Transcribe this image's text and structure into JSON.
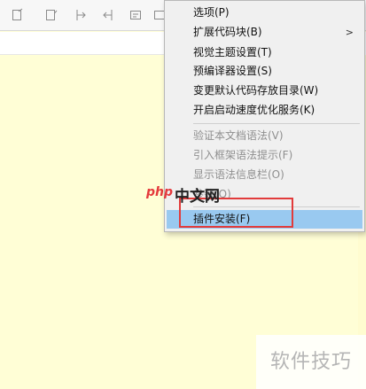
{
  "menu": {
    "items": [
      {
        "label": "选项(P)",
        "disabled": false
      },
      {
        "label": "扩展代码块(B)",
        "disabled": false,
        "submenu": true
      },
      {
        "label": "视觉主题设置(T)",
        "disabled": false
      },
      {
        "label": "预编译器设置(S)",
        "disabled": false
      },
      {
        "label": "变更默认代码存放目录(W)",
        "disabled": false
      },
      {
        "label": "开启启动速度优化服务(K)",
        "disabled": false
      },
      {
        "label": "验证本文档语法(V)",
        "disabled": true
      },
      {
        "label": "引入框架语法提示(F)",
        "disabled": true
      },
      {
        "label": "显示语法信息栏(O)",
        "disabled": true
      },
      {
        "label": "参数(Q)",
        "disabled": true
      },
      {
        "label": "插件安装(F)",
        "disabled": false,
        "selected": true
      }
    ],
    "submenu_arrow": ">"
  },
  "watermarks": {
    "logo_php": "php",
    "logo_cn": "中文网",
    "corner": "软件技巧"
  },
  "colors": {
    "editor_bg": "#fffed6",
    "menu_bg": "#f0f0f0",
    "selected_bg": "#99c9f0",
    "highlight": "#e23b3b",
    "disabled_text": "#8f8f8f"
  }
}
